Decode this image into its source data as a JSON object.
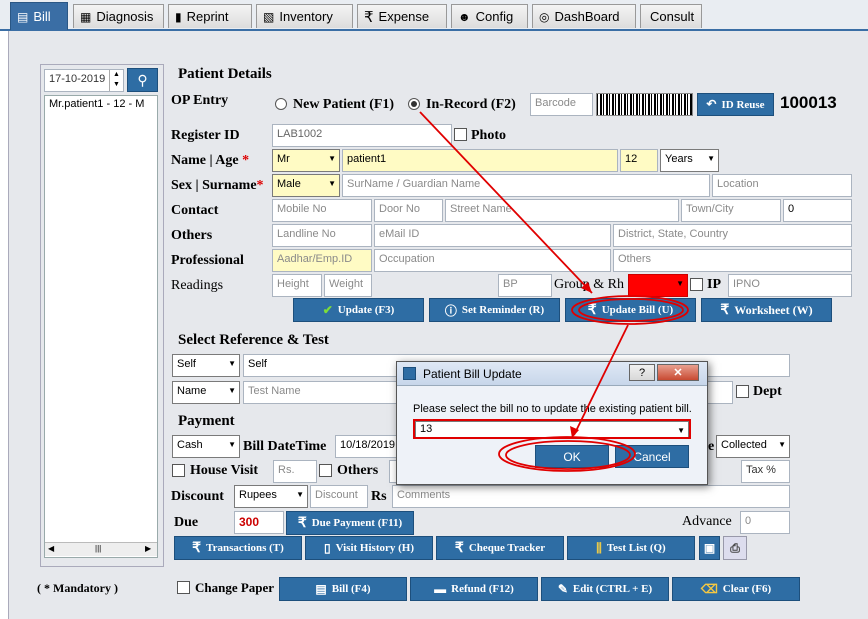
{
  "tabs": [
    {
      "label": "Bill",
      "icon": "bill-icon"
    },
    {
      "label": "Diagnosis",
      "icon": "diagnosis-icon"
    },
    {
      "label": "Reprint",
      "icon": "reprint-icon"
    },
    {
      "label": "Inventory",
      "icon": "inventory-icon"
    },
    {
      "label": "Expense",
      "icon": "rupee-icon"
    },
    {
      "label": "Config",
      "icon": "config-icon"
    },
    {
      "label": "DashBoard",
      "icon": "dashboard-icon"
    },
    {
      "label": "Consult",
      "icon": ""
    }
  ],
  "sidebar": {
    "date": "17-10-2019",
    "patient_item": "Mr.patient1 - 12 - M"
  },
  "patient": {
    "section_title": "Patient Details",
    "op_entry_label": "OP Entry",
    "new_patient_label": "New Patient (F1)",
    "in_record_label": "In-Record (F2)",
    "barcode_placeholder": "Barcode",
    "id_reuse_label": "ID Reuse",
    "patient_id": "100013",
    "register_id_label": "Register ID",
    "register_id": "LAB1002",
    "photo_label": "Photo",
    "name_age_label": "Name | Age",
    "title": "Mr",
    "name": "patient1",
    "age": "12",
    "age_unit": "Years",
    "sex_surname_label": "Sex | Surname",
    "sex": "Male",
    "surname_placeholder": "SurName / Guardian Name",
    "location_placeholder": "Location",
    "contact_label": "Contact",
    "mobile_placeholder": "Mobile No",
    "door_placeholder": "Door No",
    "street_placeholder": "Street Name",
    "town_placeholder": "Town/City",
    "pin_value": "0",
    "others_label": "Others",
    "landline_placeholder": "Landline No",
    "email_placeholder": "eMail ID",
    "district_placeholder": "District, State, Country",
    "professional_label": "Professional",
    "aadhar_placeholder": "Aadhar/Emp.ID",
    "occupation_placeholder": "Occupation",
    "others_placeholder": "Others",
    "readings_label": "Readings",
    "height_placeholder": "Height",
    "weight_placeholder": "Weight",
    "bp_placeholder": "BP",
    "group_rh_label": "Group & Rh",
    "ip_label": "IP",
    "ipno_placeholder": "IPNO",
    "update_label": "Update (F3)",
    "reminder_label": "Set Reminder (R)",
    "update_bill_label": "Update Bill (U)",
    "worksheet_label": "Worksheet (W)"
  },
  "reference": {
    "section_title": "Select Reference & Test",
    "ref_type": "Self",
    "ref_value": "Self",
    "test_by": "Name",
    "test_placeholder": "Test Name",
    "dept_label": "Dept"
  },
  "payment": {
    "section_title": "Payment",
    "mode": "Cash",
    "bill_datetime_label": "Bill DateTime",
    "bill_datetime": "10/18/2019",
    "status_suffix": "e",
    "status": "Collected",
    "house_visit_label": "House Visit",
    "rs_placeholder": "Rs.",
    "others_label": "Others",
    "tax_label": "Tax %",
    "discount_label": "Discount",
    "discount_unit": "Rupees",
    "discount_placeholder": "Discount",
    "rs_label": "Rs",
    "comments_placeholder": "Comments",
    "due_label": "Due",
    "due_value": "300",
    "due_payment_label": "Due Payment (F11)",
    "advance_label": "Advance",
    "advance_value": "0"
  },
  "bottom_buttons": {
    "transactions": "Transactions (T)",
    "visit_history": "Visit History (H)",
    "cheque_tracker": "Cheque Tracker",
    "test_list": "Test List (Q)"
  },
  "footer": {
    "mandatory": "( * Mandatory )",
    "change_paper": "Change Paper",
    "bill": "Bill (F4)",
    "refund": "Refund (F12)",
    "edit": "Edit (CTRL + E)",
    "clear": "Clear (F6)"
  },
  "dialog": {
    "title": "Patient Bill Update",
    "help": "?",
    "close": "✕",
    "message": "Please select the bill no to update the existing patient bill.",
    "bill_no": "13",
    "ok": "OK",
    "cancel": "Cancel"
  },
  "colors": {
    "accent": "#2e6da4",
    "required_yellow": "#fffbc4",
    "annotation_red": "#e00000"
  }
}
